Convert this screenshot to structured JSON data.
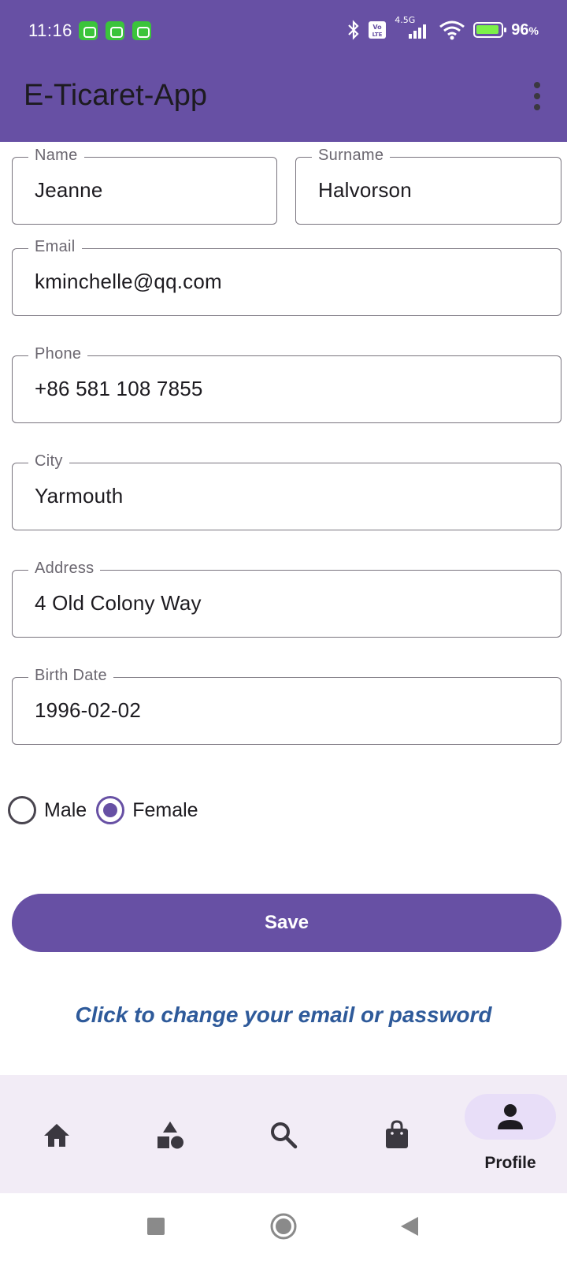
{
  "status_bar": {
    "time": "11:16",
    "battery_percent": "96",
    "battery_unit": "%",
    "network": "4.5G",
    "network_type": "VoLTE"
  },
  "app_bar": {
    "title": "E-Ticaret-App"
  },
  "form": {
    "name": {
      "label": "Name",
      "value": "Jeanne"
    },
    "surname": {
      "label": "Surname",
      "value": "Halvorson"
    },
    "email": {
      "label": "Email",
      "value": "kminchelle@qq.com"
    },
    "phone": {
      "label": "Phone",
      "value": "+86 581 108 7855"
    },
    "city": {
      "label": "City",
      "value": "Yarmouth"
    },
    "address": {
      "label": "Address",
      "value": "4 Old Colony Way"
    },
    "birth_date": {
      "label": "Birth Date",
      "value": "1996-02-02"
    },
    "gender": {
      "options": [
        {
          "label": "Male",
          "selected": false
        },
        {
          "label": "Female",
          "selected": true
        }
      ]
    },
    "save_label": "Save",
    "change_credentials_link": "Click to change your email or password"
  },
  "bottom_nav": {
    "items": [
      {
        "icon": "home-icon",
        "label": ""
      },
      {
        "icon": "categories-icon",
        "label": ""
      },
      {
        "icon": "search-icon",
        "label": ""
      },
      {
        "icon": "shopping-bag-icon",
        "label": ""
      },
      {
        "icon": "person-icon",
        "label": "Profile",
        "active": true
      }
    ]
  },
  "colors": {
    "primary": "#6750a4",
    "nav_background": "#f2ecf6",
    "nav_indicator": "#e8def8",
    "link": "#2e5a9a"
  }
}
